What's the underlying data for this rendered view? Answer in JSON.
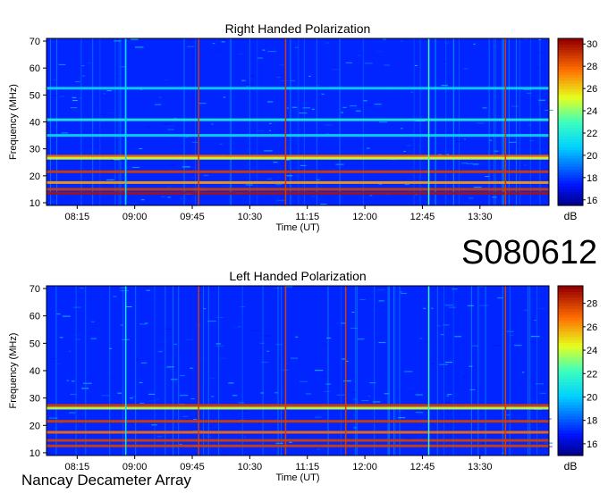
{
  "header": {
    "observation_id": "S080612",
    "observatory": "Nancay Decameter Array"
  },
  "chart_data": [
    {
      "type": "heatmap",
      "title": "Right Handed Polarization",
      "xlabel": "Time (UT)",
      "ylabel": "Frequency (MHz)",
      "xlim": [
        "07:51",
        "14:24"
      ],
      "ylim": [
        9,
        71
      ],
      "x_ticks": [
        "08:15",
        "09:00",
        "09:45",
        "10:30",
        "11:15",
        "12:00",
        "12:45",
        "13:30"
      ],
      "y_ticks": [
        10,
        20,
        30,
        40,
        50,
        60,
        70
      ],
      "colorbar": {
        "label": "dB",
        "range": [
          15.5,
          30.5
        ],
        "ticks": [
          16,
          18,
          20,
          22,
          24,
          26,
          28,
          30
        ]
      },
      "features": [
        {
          "kind": "band",
          "freq_mhz": 27.3,
          "level_db": 28
        },
        {
          "kind": "band",
          "freq_mhz": 26.5,
          "level_db": 25
        },
        {
          "kind": "band",
          "freq_mhz": 21.5,
          "level_db": 29
        },
        {
          "kind": "band",
          "freq_mhz": 17.5,
          "level_db": 27
        },
        {
          "kind": "band",
          "freq_mhz": 15.0,
          "level_db": 29
        },
        {
          "kind": "band",
          "freq_mhz": 13.5,
          "level_db": 30
        },
        {
          "kind": "band",
          "freq_mhz": 40.8,
          "level_db": 22
        },
        {
          "kind": "band",
          "freq_mhz": 35.0,
          "level_db": 21
        },
        {
          "kind": "band",
          "freq_mhz": 52.5,
          "level_db": 21
        },
        {
          "kind": "vline",
          "time": "09:50",
          "level_db": 29
        },
        {
          "kind": "vline",
          "time": "10:58",
          "level_db": 29
        },
        {
          "kind": "vline",
          "time": "13:50",
          "level_db": 29
        },
        {
          "kind": "vline",
          "time": "08:53",
          "level_db": 21
        },
        {
          "kind": "vline",
          "time": "12:50",
          "level_db": 23
        }
      ]
    },
    {
      "type": "heatmap",
      "title": "Left Handed Polarization",
      "xlabel": "Time (UT)",
      "ylabel": "Frequency (MHz)",
      "xlim": [
        "07:51",
        "14:24"
      ],
      "ylim": [
        9,
        71
      ],
      "x_ticks": [
        "08:15",
        "09:00",
        "09:45",
        "10:30",
        "11:15",
        "12:00",
        "12:45",
        "13:30"
      ],
      "y_ticks": [
        10,
        20,
        30,
        40,
        50,
        60,
        70
      ],
      "colorbar": {
        "label": "dB",
        "range": [
          15,
          29.5
        ],
        "ticks": [
          16,
          18,
          20,
          22,
          24,
          26,
          28
        ]
      },
      "features": [
        {
          "kind": "band",
          "freq_mhz": 27.3,
          "level_db": 28
        },
        {
          "kind": "band",
          "freq_mhz": 26.3,
          "level_db": 24
        },
        {
          "kind": "band",
          "freq_mhz": 21.5,
          "level_db": 28
        },
        {
          "kind": "band",
          "freq_mhz": 17.5,
          "level_db": 27
        },
        {
          "kind": "band",
          "freq_mhz": 14.5,
          "level_db": 28
        },
        {
          "kind": "band",
          "freq_mhz": 12.5,
          "level_db": 28
        },
        {
          "kind": "vline",
          "time": "09:50",
          "level_db": 28
        },
        {
          "kind": "vline",
          "time": "10:58",
          "level_db": 28
        },
        {
          "kind": "vline",
          "time": "11:45",
          "level_db": 28
        },
        {
          "kind": "vline",
          "time": "13:50",
          "level_db": 28
        },
        {
          "kind": "vline",
          "time": "08:53",
          "level_db": 21
        },
        {
          "kind": "vline",
          "time": "12:50",
          "level_db": 22
        }
      ]
    }
  ]
}
